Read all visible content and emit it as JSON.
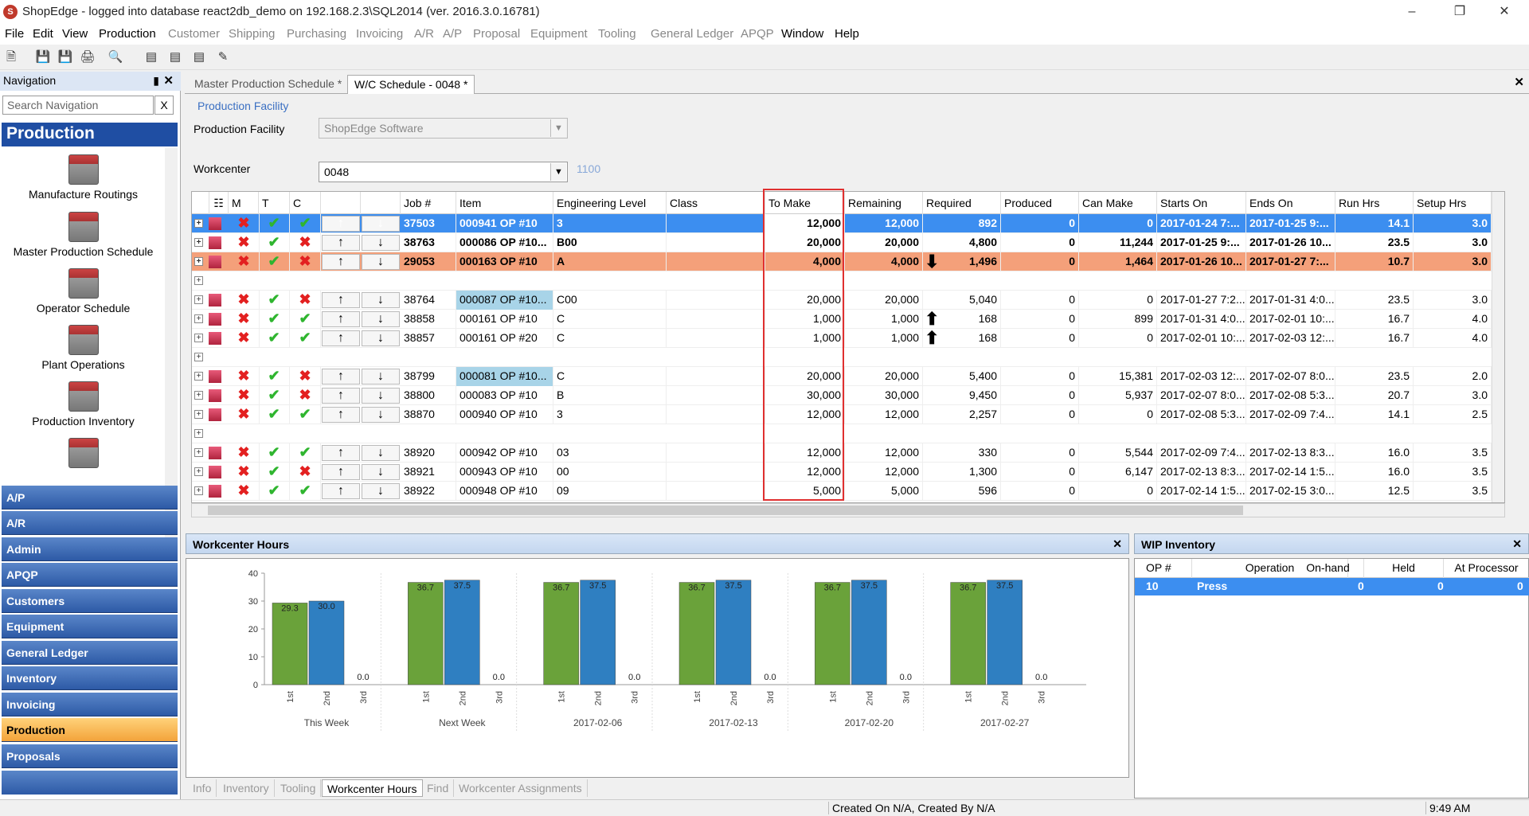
{
  "window": {
    "title": "ShopEdge -  logged into database react2db_demo on 192.168.2.3\\SQL2014 (ver. 2016.3.0.16781)"
  },
  "menu": [
    "File",
    "Edit",
    "View",
    "Production",
    "Customer",
    "Shipping",
    "Purchasing",
    "Invoicing",
    "A/R",
    "A/P",
    "Proposal",
    "Equipment",
    "Tooling",
    "General Ledger",
    "APQP",
    "Window",
    "Help"
  ],
  "nav": {
    "title": "Navigation",
    "search_placeholder": "Search Navigation",
    "search_clear": "X",
    "group": "Production",
    "items": [
      "Manufacture Routings",
      "Master Production Schedule",
      "Operator Schedule",
      "Plant Operations",
      "Production Inventory"
    ],
    "buttons": [
      "A/P",
      "A/R",
      "Admin",
      "APQP",
      "Customers",
      "Equipment",
      "General Ledger",
      "Inventory",
      "Invoicing",
      "Production",
      "Proposals"
    ],
    "active": "Production"
  },
  "tabs": [
    "Master Production Schedule *",
    "W/C Schedule - 0048 *"
  ],
  "form": {
    "section": "Production Facility",
    "facility_label": "Production Facility",
    "facility_value": "ShopEdge Software",
    "workcenter_label": "Workcenter",
    "workcenter_value": "0048",
    "workcenter_code": "1100"
  },
  "grid": {
    "headers": [
      "M",
      "T",
      "C",
      "Job #",
      "Item",
      "Engineering Level",
      "Class",
      "To Make",
      "Remaining",
      "Required",
      "Produced",
      "Can Make",
      "Starts On",
      "Ends On",
      "Run Hrs",
      "Setup Hrs",
      "T"
    ],
    "rows": [
      {
        "style": "sel",
        "m": "x",
        "t": "c",
        "c": "c",
        "job": "37503",
        "item": "000941 OP #10",
        "eng": "3",
        "make": "12,000",
        "rem": "12,000",
        "req": "892",
        "prod": "0",
        "can": "0",
        "start": "2017-01-24 7:...",
        "end": "2017-01-25 9:...",
        "run": "14.1",
        "setup": "3.0",
        "ind": ""
      },
      {
        "style": "bold",
        "m": "x",
        "t": "c",
        "c": "x",
        "job": "38763",
        "item": "000086 OP #10...",
        "eng": "B00",
        "make": "20,000",
        "rem": "20,000",
        "req": "4,800",
        "prod": "0",
        "can": "11,244",
        "start": "2017-01-25 9:...",
        "end": "2017-01-26 10...",
        "run": "23.5",
        "setup": "3.0",
        "ind": ""
      },
      {
        "style": "orange",
        "m": "x",
        "t": "c",
        "c": "x",
        "job": "29053",
        "item": "000163 OP #10",
        "eng": "A",
        "make": "4,000",
        "rem": "4,000",
        "req": "1,496",
        "prod": "0",
        "can": "1,464",
        "start": "2017-01-26 10...",
        "end": "2017-01-27 7:...",
        "run": "10.7",
        "setup": "3.0",
        "ind": "down"
      },
      {
        "style": "empty"
      },
      {
        "style": "",
        "m": "x",
        "t": "c",
        "c": "x",
        "job": "38764",
        "item": "000087 OP #10...",
        "eng": "C00",
        "make": "20,000",
        "rem": "20,000",
        "req": "5,040",
        "prod": "0",
        "can": "0",
        "start": "2017-01-27 7:2...",
        "end": "2017-01-31 4:0...",
        "run": "23.5",
        "setup": "3.0",
        "ind": "",
        "hl": true
      },
      {
        "style": "",
        "m": "x",
        "t": "c",
        "c": "c",
        "job": "38858",
        "item": "000161 OP #10",
        "eng": "C",
        "make": "1,000",
        "rem": "1,000",
        "req": "168",
        "prod": "0",
        "can": "899",
        "start": "2017-01-31 4:0...",
        "end": "2017-02-01 10:...",
        "run": "16.7",
        "setup": "4.0",
        "ind": "up"
      },
      {
        "style": "",
        "m": "x",
        "t": "c",
        "c": "c",
        "job": "38857",
        "item": "000161 OP #20",
        "eng": "C",
        "make": "1,000",
        "rem": "1,000",
        "req": "168",
        "prod": "0",
        "can": "0",
        "start": "2017-02-01 10:...",
        "end": "2017-02-03 12:...",
        "run": "16.7",
        "setup": "4.0",
        "ind": "up"
      },
      {
        "style": "empty"
      },
      {
        "style": "",
        "m": "x",
        "t": "c",
        "c": "x",
        "job": "38799",
        "item": "000081 OP #10...",
        "eng": "C",
        "make": "20,000",
        "rem": "20,000",
        "req": "5,400",
        "prod": "0",
        "can": "15,381",
        "start": "2017-02-03 12:...",
        "end": "2017-02-07 8:0...",
        "run": "23.5",
        "setup": "2.0",
        "ind": "",
        "hl": true
      },
      {
        "style": "",
        "m": "x",
        "t": "c",
        "c": "x",
        "job": "38800",
        "item": "000083 OP #10",
        "eng": "B",
        "make": "30,000",
        "rem": "30,000",
        "req": "9,450",
        "prod": "0",
        "can": "5,937",
        "start": "2017-02-07 8:0...",
        "end": "2017-02-08 5:3...",
        "run": "20.7",
        "setup": "3.0",
        "ind": ""
      },
      {
        "style": "",
        "m": "x",
        "t": "c",
        "c": "c",
        "job": "38870",
        "item": "000940 OP #10",
        "eng": "3",
        "make": "12,000",
        "rem": "12,000",
        "req": "2,257",
        "prod": "0",
        "can": "0",
        "start": "2017-02-08 5:3...",
        "end": "2017-02-09 7:4...",
        "run": "14.1",
        "setup": "2.5",
        "ind": ""
      },
      {
        "style": "empty"
      },
      {
        "style": "",
        "m": "x",
        "t": "c",
        "c": "c",
        "job": "38920",
        "item": "000942 OP #10",
        "eng": "03",
        "make": "12,000",
        "rem": "12,000",
        "req": "330",
        "prod": "0",
        "can": "5,544",
        "start": "2017-02-09 7:4...",
        "end": "2017-02-13 8:3...",
        "run": "16.0",
        "setup": "3.5",
        "ind": ""
      },
      {
        "style": "",
        "m": "x",
        "t": "c",
        "c": "x",
        "job": "38921",
        "item": "000943 OP #10",
        "eng": "00",
        "make": "12,000",
        "rem": "12,000",
        "req": "1,300",
        "prod": "0",
        "can": "6,147",
        "start": "2017-02-13 8:3...",
        "end": "2017-02-14 1:5...",
        "run": "16.0",
        "setup": "3.5",
        "ind": ""
      },
      {
        "style": "",
        "m": "x",
        "t": "c",
        "c": "c",
        "job": "38922",
        "item": "000948 OP #10",
        "eng": "09",
        "make": "5,000",
        "rem": "5,000",
        "req": "596",
        "prod": "0",
        "can": "0",
        "start": "2017-02-14 1:5...",
        "end": "2017-02-15 3:0...",
        "run": "12.5",
        "setup": "3.5",
        "ind": ""
      }
    ]
  },
  "workcenter_panel": {
    "title": "Workcenter Hours"
  },
  "chart_data": {
    "type": "bar",
    "title": "",
    "ylim": [
      0,
      40
    ],
    "yticks": [
      0,
      10,
      20,
      30,
      40
    ],
    "groups": [
      {
        "label": "This Week",
        "bars": [
          {
            "cat": "1st",
            "value": 29.3,
            "label": "29.3"
          },
          {
            "cat": "2nd",
            "value": 30.0,
            "label": "30.0"
          },
          {
            "cat": "3rd",
            "value": 0.0,
            "label": "0.0"
          }
        ]
      },
      {
        "label": "Next Week",
        "bars": [
          {
            "cat": "1st",
            "value": 36.7,
            "label": "36.7"
          },
          {
            "cat": "2nd",
            "value": 37.5,
            "label": "37.5"
          },
          {
            "cat": "3rd",
            "value": 0.0,
            "label": "0.0"
          }
        ]
      },
      {
        "label": "2017-02-06",
        "bars": [
          {
            "cat": "1st",
            "value": 36.7,
            "label": "36.7"
          },
          {
            "cat": "2nd",
            "value": 37.5,
            "label": "37.5"
          },
          {
            "cat": "3rd",
            "value": 0.0,
            "label": "0.0"
          }
        ]
      },
      {
        "label": "2017-02-13",
        "bars": [
          {
            "cat": "1st",
            "value": 36.7,
            "label": "36.7"
          },
          {
            "cat": "2nd",
            "value": 37.5,
            "label": "37.5"
          },
          {
            "cat": "3rd",
            "value": 0.0,
            "label": "0.0"
          }
        ]
      },
      {
        "label": "2017-02-20",
        "bars": [
          {
            "cat": "1st",
            "value": 36.7,
            "label": "36.7"
          },
          {
            "cat": "2nd",
            "value": 37.5,
            "label": "37.5"
          },
          {
            "cat": "3rd",
            "value": 0.0,
            "label": "0.0"
          }
        ]
      },
      {
        "label": "2017-02-27",
        "bars": [
          {
            "cat": "1st",
            "value": 36.7,
            "label": "36.7"
          },
          {
            "cat": "2nd",
            "value": 37.5,
            "label": "37.5"
          },
          {
            "cat": "3rd",
            "value": 0.0,
            "label": "0.0"
          }
        ]
      }
    ],
    "colors": {
      "1st": "#6aa23a",
      "2nd": "#2f7fc1"
    }
  },
  "bottom_tabs": [
    "Info",
    "Inventory",
    "Tooling",
    "Workcenter Hours",
    "Find",
    "Workcenter Assignments"
  ],
  "active_bottom_tab": "Workcenter Hours",
  "wip": {
    "title": "WIP Inventory",
    "headers": [
      "OP #",
      "Operation",
      "On-hand",
      "Held",
      "At Processor"
    ],
    "rows": [
      {
        "op": "10",
        "operation": "Press",
        "onhand": "0",
        "held": "0",
        "atproc": "0"
      }
    ]
  },
  "status": {
    "created": "Created On N/A, Created By N/A",
    "time": "9:49 AM"
  }
}
